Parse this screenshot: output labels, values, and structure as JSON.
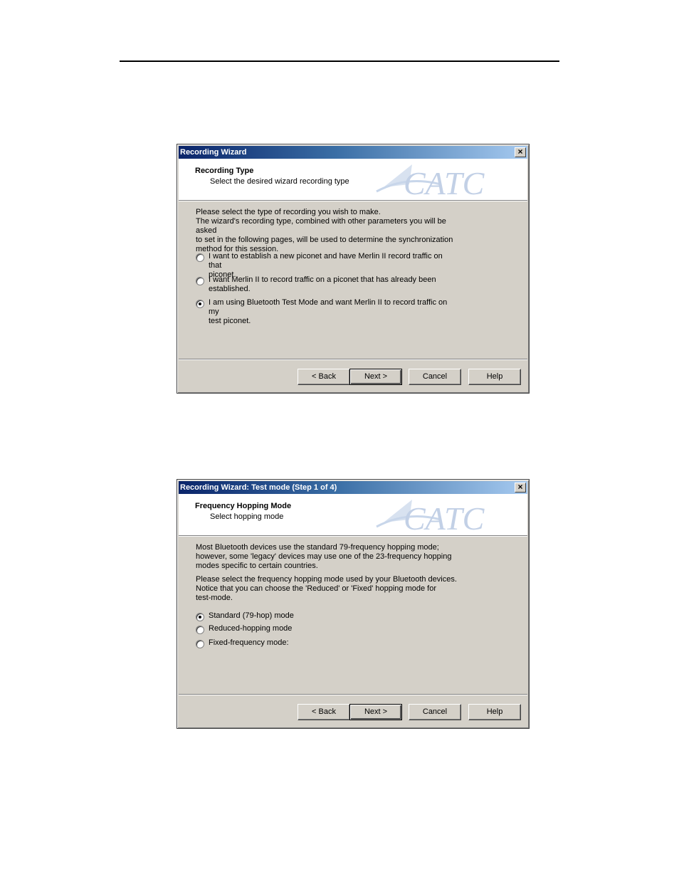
{
  "dialog1": {
    "title": "Recording Wizard",
    "header_title": "Recording Type",
    "header_sub": "Select the desired wizard recording type",
    "logo_text": "CATC",
    "description": [
      "Please select the type of recording you wish to make.",
      "The wizard's recording type, combined with other parameters you will be asked",
      "to set in the following pages, will be used to determine the synchronization",
      "method for this session."
    ],
    "options": [
      {
        "label_l1": "I want to establish a new piconet and have Merlin II  record traffic on that",
        "label_l2": "piconet.",
        "checked": false
      },
      {
        "label_l1": "I want Merlin II  to record traffic on a piconet that has already been",
        "label_l2": "established.",
        "checked": false
      },
      {
        "label_l1": "I am using Bluetooth Test Mode and want  Merlin II to record traffic on my",
        "label_l2": "test piconet.",
        "checked": true
      }
    ],
    "buttons": {
      "back": "< Back",
      "next": "Next >",
      "cancel": "Cancel",
      "help": "Help"
    }
  },
  "dialog2": {
    "title": "Recording Wizard: Test mode (Step 1 of 4)",
    "header_title": "Frequency Hopping Mode",
    "header_sub": "Select hopping mode",
    "logo_text": "CATC",
    "description1": [
      "Most Bluetooth devices use the standard 79-frequency hopping mode;",
      "however, some 'legacy' devices may use one of the 23-frequency hopping",
      "modes specific to certain countries."
    ],
    "description2": [
      "Please select the frequency hopping mode used by your Bluetooth devices.",
      "Notice that you can choose the 'Reduced' or 'Fixed' hopping mode for",
      "test-mode."
    ],
    "options": [
      {
        "label": "Standard (79-hop) mode",
        "checked": true
      },
      {
        "label": "Reduced-hopping mode",
        "checked": false
      },
      {
        "label": "Fixed-frequency mode:",
        "checked": false
      }
    ],
    "buttons": {
      "back": "< Back",
      "next": "Next >",
      "cancel": "Cancel",
      "help": "Help"
    }
  },
  "colors": {
    "title_start": "#0a246a",
    "title_end": "#a6caf0",
    "dialog_bg": "#d4d0c8",
    "logo": "#b8c8e0",
    "logo_accent": "#f0d8a0"
  }
}
